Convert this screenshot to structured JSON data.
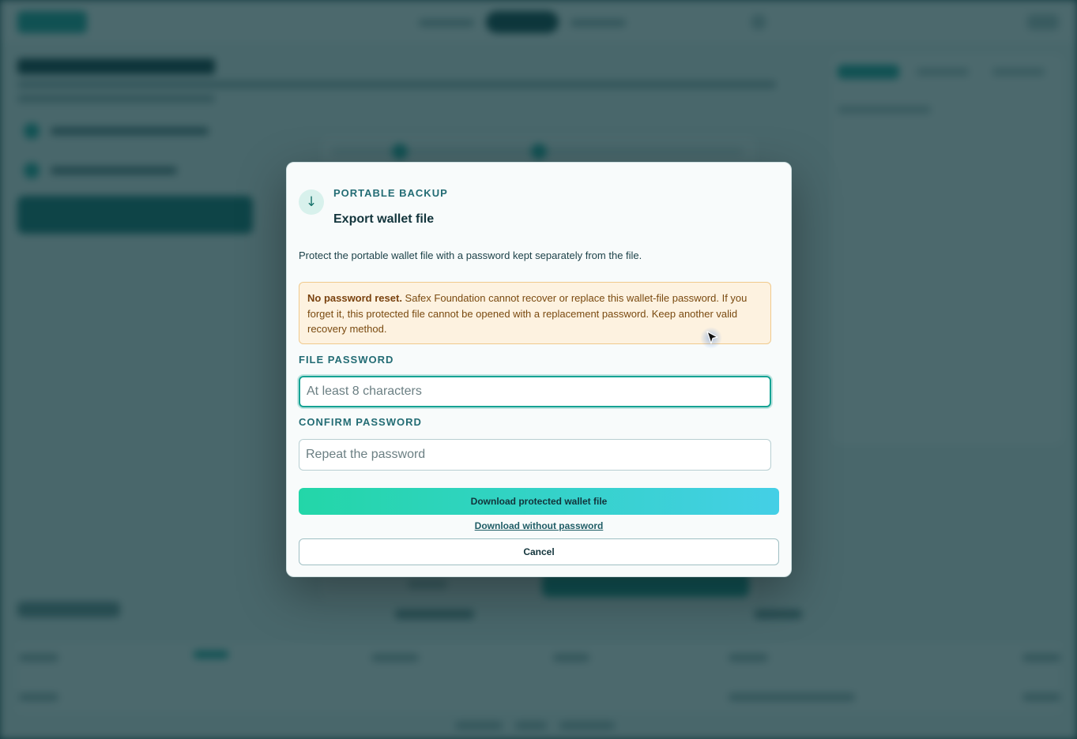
{
  "modal": {
    "icon": "download-arrow-icon",
    "icon_glyph": "↓",
    "eyebrow": "PORTABLE BACKUP",
    "title": "Export wallet file",
    "description": "Protect the portable wallet file with a password kept separately from the file.",
    "warning": {
      "bold": "No password reset.",
      "text": " Safex Foundation cannot recover or replace this wallet-file password. If you forget it, this protected file cannot be opened with a replacement password. Keep another valid recovery method."
    },
    "file_password": {
      "label": "FILE PASSWORD",
      "placeholder": "At least 8 characters",
      "value": ""
    },
    "confirm_password": {
      "label": "CONFIRM PASSWORD",
      "placeholder": "Repeat the password",
      "value": ""
    },
    "primary_button": "Download protected wallet file",
    "secondary_link": "Download without password",
    "cancel_button": "Cancel"
  },
  "colors": {
    "accent": "#16a394",
    "gradient_start": "#23d6a8",
    "gradient_end": "#44cfe6",
    "warning_bg": "#fdf2e0",
    "overlay": "#0d343a"
  }
}
